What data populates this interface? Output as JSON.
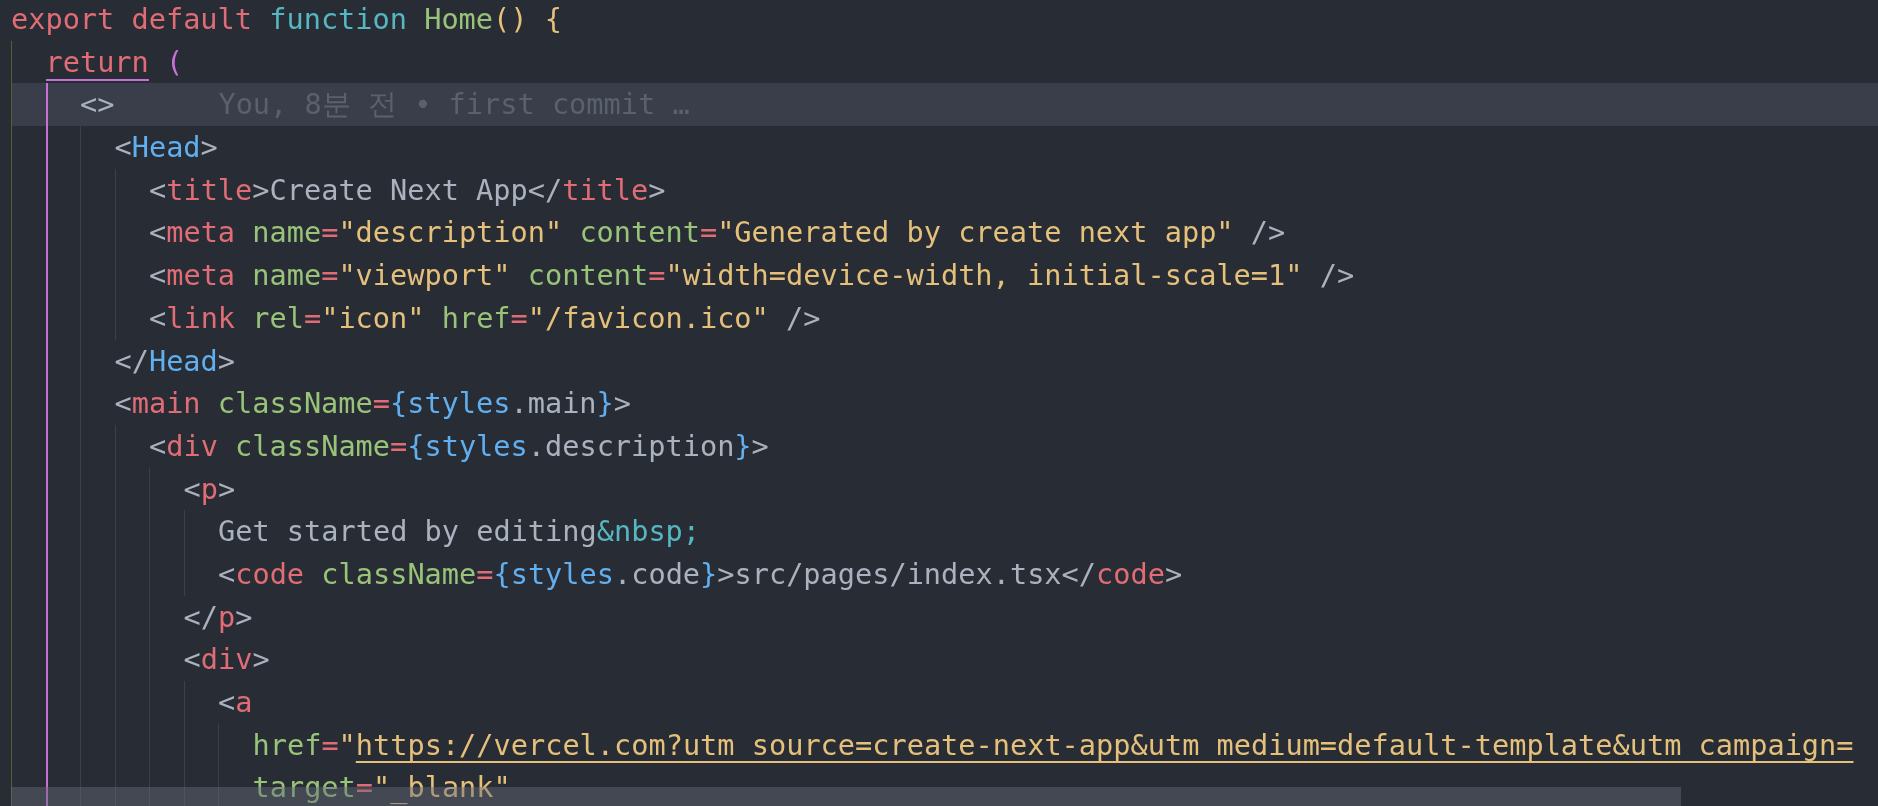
{
  "editor": {
    "lines": [
      {
        "current": false,
        "tokens": [
          {
            "text": "export",
            "kind": "keyword"
          },
          {
            "text": " default",
            "kind": "keyword"
          },
          {
            "text": " function",
            "kind": "storage"
          },
          {
            "text": " Home",
            "kind": "function"
          },
          {
            "text": "() {",
            "kind": "bracket"
          }
        ],
        "children": [
          {
            "current": false,
            "active_bracket": true,
            "tokens": [
              {
                "text": "return",
                "kind": "keyword"
              },
              {
                "text": " (",
                "kind": "bracket2"
              }
            ],
            "children": [
              {
                "current": true,
                "blame": "You, 8분 전 • first commit …",
                "tokens": [
                  {
                    "text": "<>",
                    "kind": "punct"
                  }
                ],
                "children": [
                  {
                    "current": false,
                    "tokens": [
                      {
                        "text": "<",
                        "kind": "punct"
                      },
                      {
                        "text": "Head",
                        "kind": "component"
                      },
                      {
                        "text": ">",
                        "kind": "punct"
                      }
                    ],
                    "children": [
                      {
                        "current": false,
                        "tokens": [
                          {
                            "text": "<",
                            "kind": "punct"
                          },
                          {
                            "text": "title",
                            "kind": "tag"
                          },
                          {
                            "text": ">",
                            "kind": "punct"
                          },
                          {
                            "text": "Create Next App",
                            "kind": "text"
                          },
                          {
                            "text": "</",
                            "kind": "punct"
                          },
                          {
                            "text": "title",
                            "kind": "tag"
                          },
                          {
                            "text": ">",
                            "kind": "punct"
                          }
                        ]
                      },
                      {
                        "current": false,
                        "tokens": [
                          {
                            "text": "<",
                            "kind": "punct"
                          },
                          {
                            "text": "meta",
                            "kind": "tag"
                          },
                          {
                            "text": " name",
                            "kind": "attr"
                          },
                          {
                            "text": "=",
                            "kind": "operator"
                          },
                          {
                            "text": "\"description\"",
                            "kind": "string"
                          },
                          {
                            "text": " content",
                            "kind": "attr"
                          },
                          {
                            "text": "=",
                            "kind": "operator"
                          },
                          {
                            "text": "\"Generated by create next app\"",
                            "kind": "string"
                          },
                          {
                            "text": " />",
                            "kind": "punct"
                          }
                        ]
                      },
                      {
                        "current": false,
                        "tokens": [
                          {
                            "text": "<",
                            "kind": "punct"
                          },
                          {
                            "text": "meta",
                            "kind": "tag"
                          },
                          {
                            "text": " name",
                            "kind": "attr"
                          },
                          {
                            "text": "=",
                            "kind": "operator"
                          },
                          {
                            "text": "\"viewport\"",
                            "kind": "string"
                          },
                          {
                            "text": " content",
                            "kind": "attr"
                          },
                          {
                            "text": "=",
                            "kind": "operator"
                          },
                          {
                            "text": "\"width=device-width, initial-scale=1\"",
                            "kind": "string"
                          },
                          {
                            "text": " />",
                            "kind": "punct"
                          }
                        ]
                      },
                      {
                        "current": false,
                        "tokens": [
                          {
                            "text": "<",
                            "kind": "punct"
                          },
                          {
                            "text": "link",
                            "kind": "tag"
                          },
                          {
                            "text": " rel",
                            "kind": "attr"
                          },
                          {
                            "text": "=",
                            "kind": "operator"
                          },
                          {
                            "text": "\"icon\"",
                            "kind": "string"
                          },
                          {
                            "text": " href",
                            "kind": "attr"
                          },
                          {
                            "text": "=",
                            "kind": "operator"
                          },
                          {
                            "text": "\"/favicon.ico\"",
                            "kind": "string"
                          },
                          {
                            "text": " />",
                            "kind": "punct"
                          }
                        ]
                      }
                    ]
                  },
                  {
                    "current": false,
                    "tokens": [
                      {
                        "text": "</",
                        "kind": "punct"
                      },
                      {
                        "text": "Head",
                        "kind": "component"
                      },
                      {
                        "text": ">",
                        "kind": "punct"
                      }
                    ]
                  },
                  {
                    "current": false,
                    "tokens": [
                      {
                        "text": "<",
                        "kind": "punct"
                      },
                      {
                        "text": "main",
                        "kind": "tag"
                      },
                      {
                        "text": " className",
                        "kind": "attr"
                      },
                      {
                        "text": "=",
                        "kind": "operator"
                      },
                      {
                        "text": "{styles",
                        "kind": "variable"
                      },
                      {
                        "text": ".main",
                        "kind": "text"
                      },
                      {
                        "text": "}",
                        "kind": "variable"
                      },
                      {
                        "text": ">",
                        "kind": "punct"
                      }
                    ],
                    "children": [
                      {
                        "current": false,
                        "tokens": [
                          {
                            "text": "<",
                            "kind": "punct"
                          },
                          {
                            "text": "div",
                            "kind": "tag"
                          },
                          {
                            "text": " className",
                            "kind": "attr"
                          },
                          {
                            "text": "=",
                            "kind": "operator"
                          },
                          {
                            "text": "{styles",
                            "kind": "variable"
                          },
                          {
                            "text": ".description",
                            "kind": "text"
                          },
                          {
                            "text": "}",
                            "kind": "variable"
                          },
                          {
                            "text": ">",
                            "kind": "punct"
                          }
                        ],
                        "children": [
                          {
                            "current": false,
                            "tokens": [
                              {
                                "text": "<",
                                "kind": "punct"
                              },
                              {
                                "text": "p",
                                "kind": "tag"
                              },
                              {
                                "text": ">",
                                "kind": "punct"
                              }
                            ],
                            "children": [
                              {
                                "current": false,
                                "tokens": [
                                  {
                                    "text": "Get started by editing",
                                    "kind": "text"
                                  },
                                  {
                                    "text": "&nbsp;",
                                    "kind": "entity"
                                  }
                                ]
                              },
                              {
                                "current": false,
                                "tokens": [
                                  {
                                    "text": "<",
                                    "kind": "punct"
                                  },
                                  {
                                    "text": "code",
                                    "kind": "tag"
                                  },
                                  {
                                    "text": " className",
                                    "kind": "attr"
                                  },
                                  {
                                    "text": "=",
                                    "kind": "operator"
                                  },
                                  {
                                    "text": "{styles",
                                    "kind": "variable"
                                  },
                                  {
                                    "text": ".code",
                                    "kind": "text"
                                  },
                                  {
                                    "text": "}",
                                    "kind": "variable"
                                  },
                                  {
                                    "text": ">src/pages/index.tsx</",
                                    "kind": "punct"
                                  },
                                  {
                                    "text": "code",
                                    "kind": "tag"
                                  },
                                  {
                                    "text": ">",
                                    "kind": "punct"
                                  }
                                ]
                              }
                            ]
                          },
                          {
                            "current": false,
                            "tokens": [
                              {
                                "text": "</",
                                "kind": "punct"
                              },
                              {
                                "text": "p",
                                "kind": "tag"
                              },
                              {
                                "text": ">",
                                "kind": "punct"
                              }
                            ]
                          },
                          {
                            "current": false,
                            "tokens": [
                              {
                                "text": "<",
                                "kind": "punct"
                              },
                              {
                                "text": "div",
                                "kind": "tag"
                              },
                              {
                                "text": ">",
                                "kind": "punct"
                              }
                            ],
                            "children": [
                              {
                                "current": false,
                                "tokens": [
                                  {
                                    "text": "<",
                                    "kind": "punct"
                                  },
                                  {
                                    "text": "a",
                                    "kind": "tag"
                                  }
                                ],
                                "children": [
                                  {
                                    "current": false,
                                    "tokens": [
                                      {
                                        "text": "href",
                                        "kind": "attr"
                                      },
                                      {
                                        "text": "=",
                                        "kind": "operator"
                                      },
                                      {
                                        "text": "\"",
                                        "kind": "string"
                                      },
                                      {
                                        "text": "https://vercel.com?utm_source=create-next-app&utm_medium=default-template&utm_campaign=",
                                        "kind": "link"
                                      }
                                    ]
                                  },
                                  {
                                    "current": false,
                                    "tokens": [
                                      {
                                        "text": "target",
                                        "kind": "attr"
                                      },
                                      {
                                        "text": "=",
                                        "kind": "operator"
                                      },
                                      {
                                        "text": "\"_blank\"",
                                        "kind": "string"
                                      }
                                    ]
                                  }
                                ]
                              }
                            ]
                          }
                        ]
                      }
                    ]
                  }
                ]
              }
            ]
          }
        ]
      }
    ]
  }
}
